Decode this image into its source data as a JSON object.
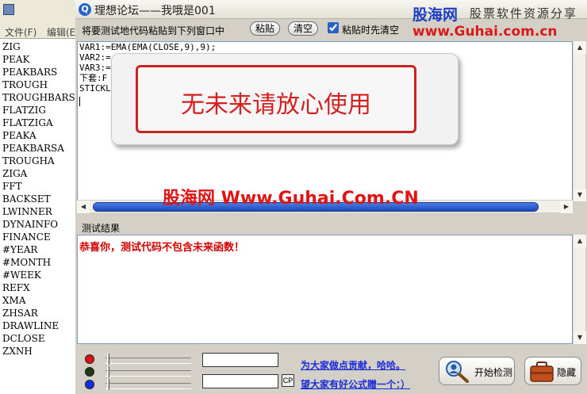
{
  "left_window": {
    "menu": [
      "文件(F)",
      "编辑(E)"
    ],
    "functions": [
      "ZIG",
      "PEAK",
      "PEAKBARS",
      "TROUGH",
      "TROUGHBARS",
      "FLATZIG",
      "FLATZIGA",
      "PEAKA",
      "PEAKBARSA",
      "TROUGHA",
      "ZIGA",
      "FFT",
      "BACKSET",
      "LWINNER",
      "DYNAINFO",
      "FINANCE",
      "#YEAR",
      "#MONTH",
      "#WEEK",
      "REFX",
      "XMA",
      "ZHSAR",
      "DRAWLINE",
      "DCLOSE",
      "ZXNH"
    ]
  },
  "main_window": {
    "app_icon": "Q",
    "title": "理想论坛——我哦是001",
    "brand": {
      "name": "股海网",
      "tagline": "股票软件资源分享",
      "url": "www.Guhai.com.cn"
    },
    "toolbar": {
      "paste_hint": "将要测试地代码粘贴到下列窗口中",
      "paste_label": "粘贴",
      "clear_label": "清空",
      "auto_clear_label": "粘贴时先清空",
      "auto_clear_checked": true
    },
    "code_lines": [
      "VAR1:=EMA(EMA(CLOSE,9),9);",
      "VAR2:=",
      "VAR3:=",
      "下套:F",
      "STICKL                                           0.6,0,1,0),COLORFFOO"
    ],
    "popup_message": "无未来请放心使用",
    "watermark": "股海网 Www.Guhai.Com.CN",
    "result_label": "测试结果",
    "result_text": "恭喜你，测试代码不包含未来函数！",
    "bottom": {
      "cp_label": "CP",
      "link_contribute": "为大家做点贡献，哈哈。",
      "link_share": "望大家有好公式赠一个：）",
      "start_button": "开始检测",
      "hide_button": "隐藏"
    }
  }
}
